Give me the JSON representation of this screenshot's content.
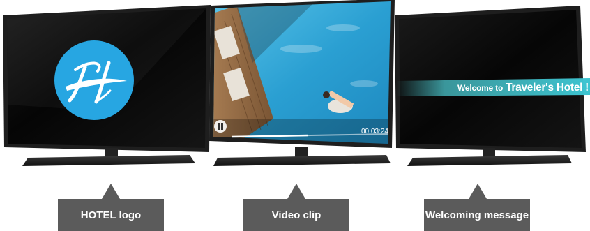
{
  "screens": [
    {
      "id": "logo-tv",
      "caption": "HOTEL logo",
      "content": "hotel-logo-circle",
      "logo_color": "#27a6e2"
    },
    {
      "id": "video-tv",
      "caption": "Video clip",
      "content": "pool-video-frame",
      "timecode": "00:03:24",
      "playback_progress": 0.49,
      "control_icon": "pause-icon"
    },
    {
      "id": "message-tv",
      "caption": "Welcoming message",
      "content": "welcome-banner"
    }
  ],
  "welcome": {
    "prefix": "Welcome to",
    "name": "Traveler's Hotel !",
    "banner_color": "#4fd2d9"
  },
  "colors": {
    "label_box": "#5b5b5b",
    "screen_bg": "#0a0a0a",
    "bezel": "#1c1c1c"
  }
}
